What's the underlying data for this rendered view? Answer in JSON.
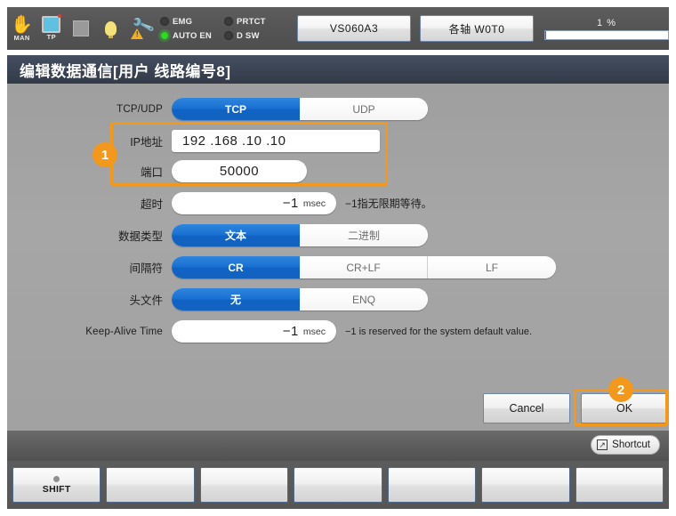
{
  "statusbar": {
    "mode_icon_label": "MAN",
    "tp_icon_label": "TP",
    "leds": [
      {
        "label": "EMG",
        "on": false
      },
      {
        "label": "PRTCT",
        "on": false
      },
      {
        "label": "AUTO EN",
        "on": true
      },
      {
        "label": "D SW",
        "on": false
      }
    ],
    "robot_button": "VS060A3",
    "axis_button": "各轴 W0T0",
    "speed_value": "1 %",
    "speed_percent": 1
  },
  "title": "编辑数据通信[用户 线路编号8]",
  "form": {
    "protocol": {
      "label": "TCP/UDP",
      "options": [
        "TCP",
        "UDP"
      ],
      "selected": "TCP"
    },
    "ip": {
      "label": "IP地址",
      "value": "192 .168 .10 .10"
    },
    "port": {
      "label": "端口",
      "value": "50000"
    },
    "timeout": {
      "label": "超时",
      "value": "−1",
      "unit": "msec",
      "hint": "−1指无限期等待。"
    },
    "datatype": {
      "label": "数据类型",
      "options": [
        "文本",
        "二进制"
      ],
      "selected": "文本"
    },
    "delimiter": {
      "label": "间隔符",
      "options": [
        "CR",
        "CR+LF",
        "LF"
      ],
      "selected": "CR"
    },
    "header": {
      "label": "头文件",
      "options": [
        "无",
        "ENQ"
      ],
      "selected": "无"
    },
    "keepalive": {
      "label": "Keep-Alive Time",
      "value": "−1",
      "unit": "msec",
      "hint": "−1 is reserved for the system default value."
    }
  },
  "buttons": {
    "cancel": "Cancel",
    "ok": "OK",
    "shortcut": "Shortcut"
  },
  "annotations": [
    {
      "number": "1"
    },
    {
      "number": "2"
    }
  ],
  "function_keys": [
    {
      "label": "SHIFT",
      "has_dot": true
    },
    {
      "label": "",
      "has_dot": false
    },
    {
      "label": "",
      "has_dot": false
    },
    {
      "label": "",
      "has_dot": false
    },
    {
      "label": "",
      "has_dot": false
    },
    {
      "label": "",
      "has_dot": false
    },
    {
      "label": "",
      "has_dot": false
    }
  ],
  "colors": {
    "accent_blue": "#1a6fd0",
    "annotation_orange": "#f2981d",
    "panel_gray": "#a2a2a2",
    "titlebar": "#3b4454"
  }
}
